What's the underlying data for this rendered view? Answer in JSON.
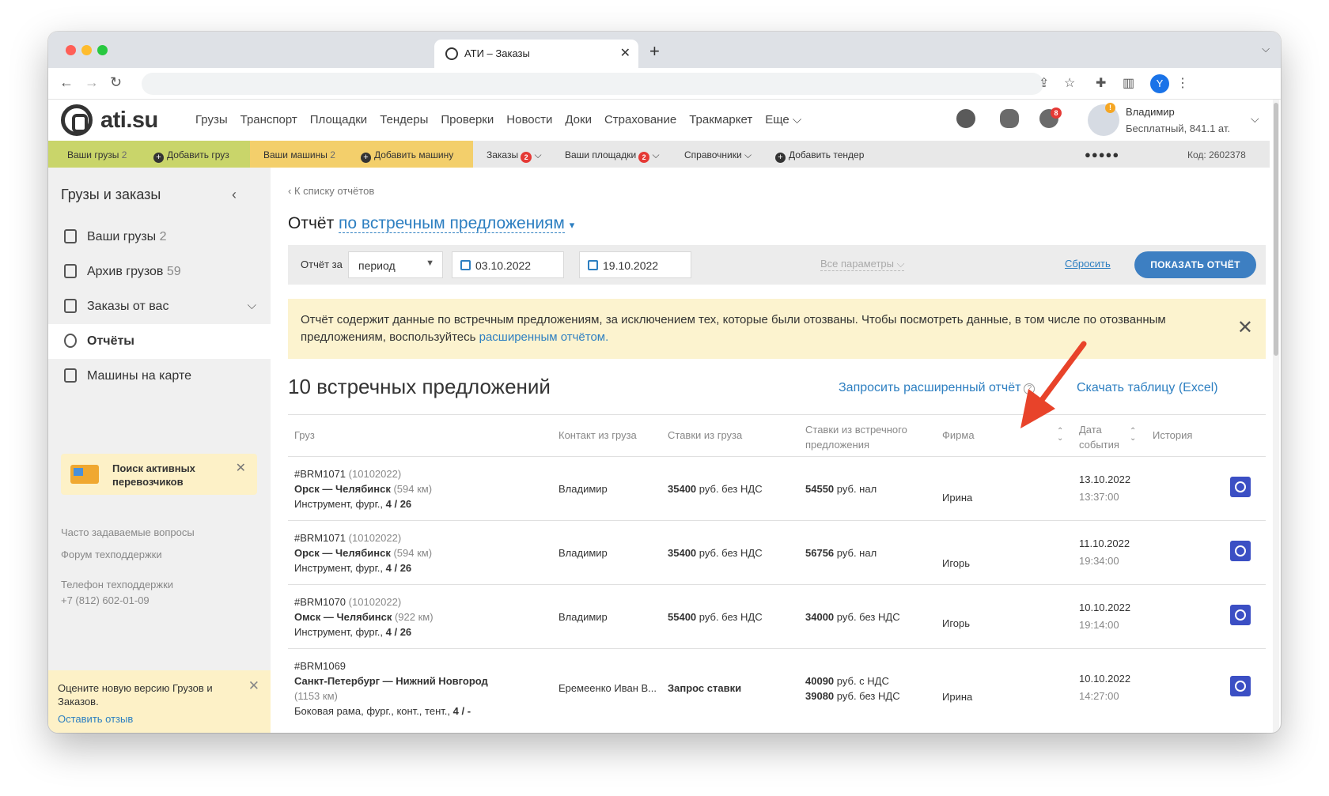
{
  "browser": {
    "tab_title": "АТИ – Заказы",
    "tab_close": "✕",
    "new_tab": "+"
  },
  "site": {
    "logo": "ati.su",
    "nav": [
      "Грузы",
      "Транспорт",
      "Площадки",
      "Тендеры",
      "Проверки",
      "Новости",
      "Доки",
      "Страхование",
      "Тракмаркет",
      "Еще ⌵"
    ],
    "notif_count": "8",
    "avatar_badge": "!",
    "user_name": "Владимир",
    "user_plan": "Бесплатный,  841.1 ат."
  },
  "subnav": {
    "cargo": "Ваши грузы",
    "cargo_count": "2",
    "add_cargo": "Добавить груз",
    "cars": "Ваши машины",
    "cars_count": "2",
    "add_car": "Добавить машину",
    "orders": "Заказы",
    "orders_count": "2",
    "platforms": "Ваши площадки",
    "platforms_count": "2",
    "references": "Справочники",
    "add_tender": "Добавить тендер",
    "code": "Код: 2602378"
  },
  "sidebar": {
    "title": "Грузы и заказы",
    "items": [
      {
        "label": "Ваши грузы",
        "count": "2"
      },
      {
        "label": "Архив грузов",
        "count": "59"
      },
      {
        "label": "Заказы от вас",
        "count": ""
      },
      {
        "label": "Отчёты",
        "count": ""
      },
      {
        "label": "Машины на карте",
        "count": ""
      }
    ],
    "promo": "Поиск активных перевозчиков",
    "faq": "Часто задаваемые вопросы",
    "forum": "Форум техподдержки",
    "phone_label": "Телефон техподдержки",
    "phone": "+7 (812) 602-01-09",
    "feedback_text": "Оцените новую версию Грузов и Заказов.",
    "feedback_link": "Оставить отзыв"
  },
  "report": {
    "back": "К списку отчётов",
    "title_prefix": "Отчёт",
    "title_link": "по встречным предложениям",
    "filter_label": "Отчёт за",
    "period": "период",
    "date_from": "03.10.2022",
    "date_to": "19.10.2022",
    "dash": "—",
    "all_params": "Все параметры ⌵",
    "reset": "Сбросить",
    "show": "ПОКАЗАТЬ ОТЧЁТ",
    "notice": "Отчёт содержит данные по встречным предложениям, за исключением тех, которые были отозваны. Чтобы посмотреть данные, в том числе по отозванным предложениям, воспользуйтесь",
    "notice_link": "расширенным отчётом.",
    "count_title": "10 встречных предложений",
    "request_link": "Запросить расширенный отчёт",
    "excel_link": "Скачать таблицу (Excel)"
  },
  "table": {
    "headers": {
      "cargo": "Груз",
      "contact": "Контакт из груза",
      "rates": "Ставки из груза",
      "counter_rates": "Ставки из встречного предложения",
      "firm": "Фирма",
      "date": "Дата события",
      "history": "История"
    },
    "rows": [
      {
        "id": "#BRM1071",
        "ref": "(10102022)",
        "route": "Орск — Челябинск",
        "km": "(594 км)",
        "details": "Инструмент, фург.,",
        "load": "4 / 26",
        "contact": "Владимир",
        "rate": "35400",
        "rate_unit": "руб. без НДС",
        "counter": "54550",
        "counter_unit": "руб. нал",
        "firm": "Ирина",
        "date": "13.10.2022",
        "time": "13:37:00"
      },
      {
        "id": "#BRM1071",
        "ref": "(10102022)",
        "route": "Орск — Челябинск",
        "km": "(594 км)",
        "details": "Инструмент, фург.,",
        "load": "4 / 26",
        "contact": "Владимир",
        "rate": "35400",
        "rate_unit": "руб. без НДС",
        "counter": "56756",
        "counter_unit": "руб. нал",
        "firm": "Игорь",
        "date": "11.10.2022",
        "time": "19:34:00"
      },
      {
        "id": "#BRM1070",
        "ref": "(10102022)",
        "route": "Омск — Челябинск",
        "km": "(922 км)",
        "details": "Инструмент, фург.,",
        "load": "4 / 26",
        "contact": "Владимир",
        "rate": "55400",
        "rate_unit": "руб. без НДС",
        "counter": "34000",
        "counter_unit": "руб. без НДС",
        "firm": "Игорь",
        "date": "10.10.2022",
        "time": "19:14:00"
      },
      {
        "id": "#BRM1069",
        "ref": "",
        "route": "Санкт-Петербург — Нижний Новгород",
        "km": "(1153 км)",
        "details": "Боковая рама, фург., конт., тент.,",
        "load": "4 / -",
        "contact": "Еремеенко Иван В...",
        "rate": "Запрос ставки",
        "rate_unit": "",
        "counter": "40090",
        "counter_unit": "руб. с НДС",
        "counter2": "39080",
        "counter2_unit": "руб. без НДС",
        "firm": "Ирина",
        "date": "10.10.2022",
        "time": "14:27:00"
      }
    ]
  },
  "colors": {
    "link": "#2d7fc1",
    "button": "#3d7fc2",
    "notice_bg": "#fcf3cf",
    "arrow": "#e8432a",
    "history_btn": "#3b4fc4"
  }
}
